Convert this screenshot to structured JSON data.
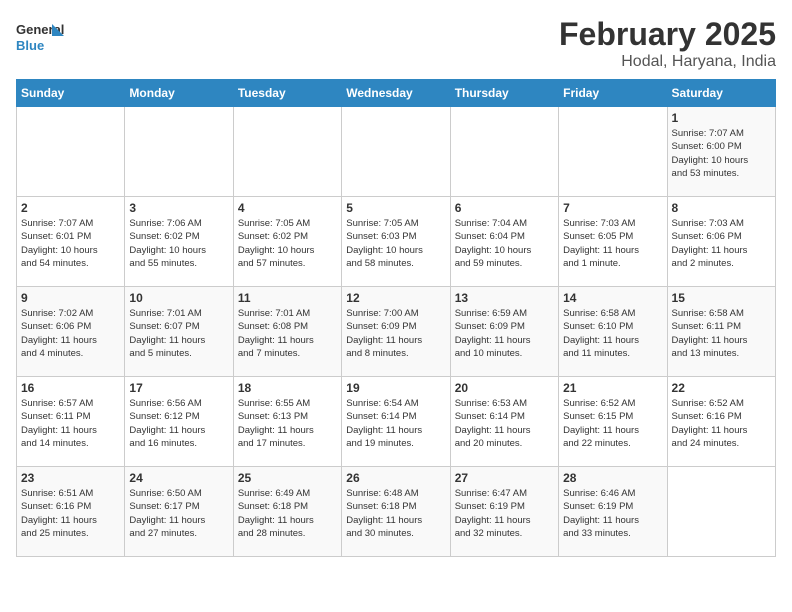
{
  "header": {
    "logo_general": "General",
    "logo_blue": "Blue",
    "title": "February 2025",
    "subtitle": "Hodal, Haryana, India"
  },
  "columns": [
    "Sunday",
    "Monday",
    "Tuesday",
    "Wednesday",
    "Thursday",
    "Friday",
    "Saturday"
  ],
  "weeks": [
    [
      {
        "day": "",
        "info": ""
      },
      {
        "day": "",
        "info": ""
      },
      {
        "day": "",
        "info": ""
      },
      {
        "day": "",
        "info": ""
      },
      {
        "day": "",
        "info": ""
      },
      {
        "day": "",
        "info": ""
      },
      {
        "day": "1",
        "info": "Sunrise: 7:07 AM\nSunset: 6:00 PM\nDaylight: 10 hours\nand 53 minutes."
      }
    ],
    [
      {
        "day": "2",
        "info": "Sunrise: 7:07 AM\nSunset: 6:01 PM\nDaylight: 10 hours\nand 54 minutes."
      },
      {
        "day": "3",
        "info": "Sunrise: 7:06 AM\nSunset: 6:02 PM\nDaylight: 10 hours\nand 55 minutes."
      },
      {
        "day": "4",
        "info": "Sunrise: 7:05 AM\nSunset: 6:02 PM\nDaylight: 10 hours\nand 57 minutes."
      },
      {
        "day": "5",
        "info": "Sunrise: 7:05 AM\nSunset: 6:03 PM\nDaylight: 10 hours\nand 58 minutes."
      },
      {
        "day": "6",
        "info": "Sunrise: 7:04 AM\nSunset: 6:04 PM\nDaylight: 10 hours\nand 59 minutes."
      },
      {
        "day": "7",
        "info": "Sunrise: 7:03 AM\nSunset: 6:05 PM\nDaylight: 11 hours\nand 1 minute."
      },
      {
        "day": "8",
        "info": "Sunrise: 7:03 AM\nSunset: 6:06 PM\nDaylight: 11 hours\nand 2 minutes."
      }
    ],
    [
      {
        "day": "9",
        "info": "Sunrise: 7:02 AM\nSunset: 6:06 PM\nDaylight: 11 hours\nand 4 minutes."
      },
      {
        "day": "10",
        "info": "Sunrise: 7:01 AM\nSunset: 6:07 PM\nDaylight: 11 hours\nand 5 minutes."
      },
      {
        "day": "11",
        "info": "Sunrise: 7:01 AM\nSunset: 6:08 PM\nDaylight: 11 hours\nand 7 minutes."
      },
      {
        "day": "12",
        "info": "Sunrise: 7:00 AM\nSunset: 6:09 PM\nDaylight: 11 hours\nand 8 minutes."
      },
      {
        "day": "13",
        "info": "Sunrise: 6:59 AM\nSunset: 6:09 PM\nDaylight: 11 hours\nand 10 minutes."
      },
      {
        "day": "14",
        "info": "Sunrise: 6:58 AM\nSunset: 6:10 PM\nDaylight: 11 hours\nand 11 minutes."
      },
      {
        "day": "15",
        "info": "Sunrise: 6:58 AM\nSunset: 6:11 PM\nDaylight: 11 hours\nand 13 minutes."
      }
    ],
    [
      {
        "day": "16",
        "info": "Sunrise: 6:57 AM\nSunset: 6:11 PM\nDaylight: 11 hours\nand 14 minutes."
      },
      {
        "day": "17",
        "info": "Sunrise: 6:56 AM\nSunset: 6:12 PM\nDaylight: 11 hours\nand 16 minutes."
      },
      {
        "day": "18",
        "info": "Sunrise: 6:55 AM\nSunset: 6:13 PM\nDaylight: 11 hours\nand 17 minutes."
      },
      {
        "day": "19",
        "info": "Sunrise: 6:54 AM\nSunset: 6:14 PM\nDaylight: 11 hours\nand 19 minutes."
      },
      {
        "day": "20",
        "info": "Sunrise: 6:53 AM\nSunset: 6:14 PM\nDaylight: 11 hours\nand 20 minutes."
      },
      {
        "day": "21",
        "info": "Sunrise: 6:52 AM\nSunset: 6:15 PM\nDaylight: 11 hours\nand 22 minutes."
      },
      {
        "day": "22",
        "info": "Sunrise: 6:52 AM\nSunset: 6:16 PM\nDaylight: 11 hours\nand 24 minutes."
      }
    ],
    [
      {
        "day": "23",
        "info": "Sunrise: 6:51 AM\nSunset: 6:16 PM\nDaylight: 11 hours\nand 25 minutes."
      },
      {
        "day": "24",
        "info": "Sunrise: 6:50 AM\nSunset: 6:17 PM\nDaylight: 11 hours\nand 27 minutes."
      },
      {
        "day": "25",
        "info": "Sunrise: 6:49 AM\nSunset: 6:18 PM\nDaylight: 11 hours\nand 28 minutes."
      },
      {
        "day": "26",
        "info": "Sunrise: 6:48 AM\nSunset: 6:18 PM\nDaylight: 11 hours\nand 30 minutes."
      },
      {
        "day": "27",
        "info": "Sunrise: 6:47 AM\nSunset: 6:19 PM\nDaylight: 11 hours\nand 32 minutes."
      },
      {
        "day": "28",
        "info": "Sunrise: 6:46 AM\nSunset: 6:19 PM\nDaylight: 11 hours\nand 33 minutes."
      },
      {
        "day": "",
        "info": ""
      }
    ]
  ]
}
